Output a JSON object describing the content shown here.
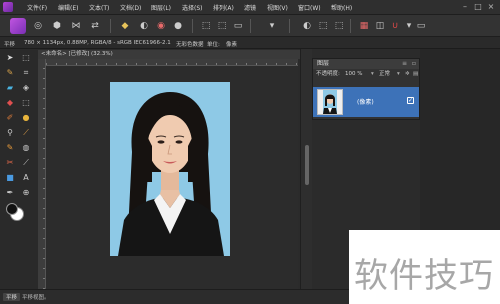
{
  "menubar": {
    "items": [
      "文件(F)",
      "编辑(E)",
      "文本(T)",
      "文档(D)",
      "图层(L)",
      "选择(S)",
      "排列(A)",
      "滤镜",
      "视图(V)",
      "窗口(W)",
      "帮助(H)"
    ]
  },
  "context": {
    "mode": "平移",
    "doc_info": "780 × 1134px, 0.88MP, RGBA/8 - sRGB IEC61966-2.1",
    "color_profile": "无彩色数据",
    "unit_label": "单位:",
    "unit_value": "像素"
  },
  "document": {
    "tab_title": "<未命名> [已修改] (32.3%)"
  },
  "layers_panel": {
    "title": "图层",
    "opacity_label": "不透明度:",
    "opacity_value": "100 %",
    "blend_mode": "正常",
    "layer_name": "(像素)",
    "layer_checked": "✓"
  },
  "status": {
    "text": "平移视图。"
  },
  "watermark": {
    "text": "软件技巧"
  },
  "colors": {
    "accent": "#3d72b8",
    "photo_background": "#8ec9e6",
    "app_bg": "#2b2b2b"
  }
}
